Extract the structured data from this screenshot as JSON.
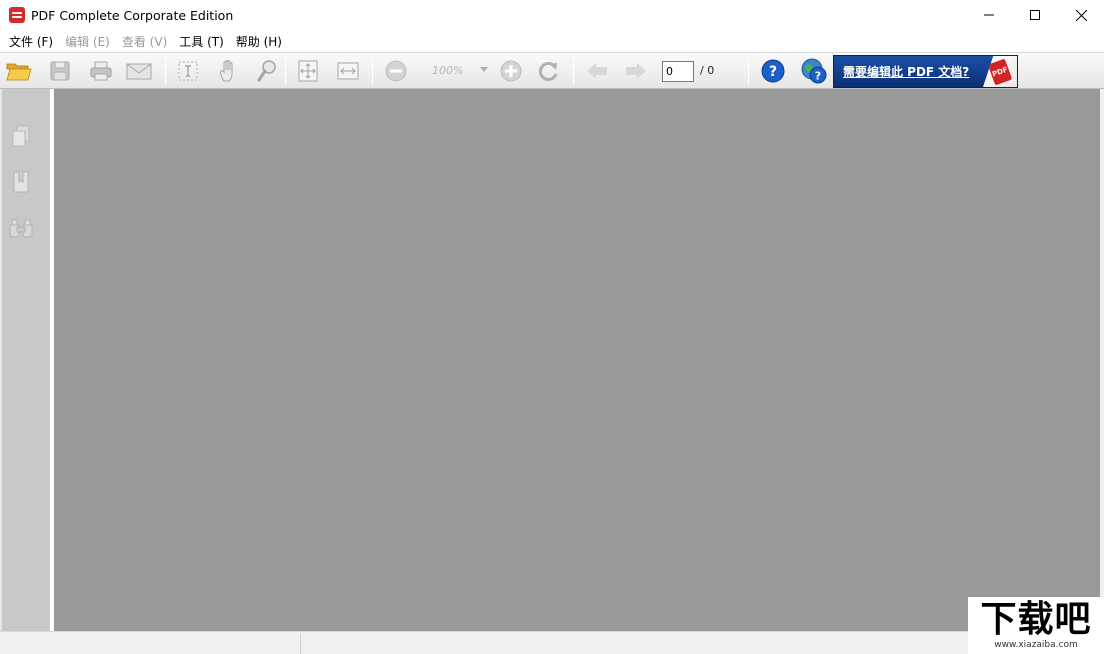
{
  "window": {
    "title": "PDF Complete Corporate Edition",
    "icon": "pdf-complete-app-icon"
  },
  "menu": {
    "items": [
      {
        "label": "文件 (F)",
        "enabled": true
      },
      {
        "label": "编辑 (E)",
        "enabled": false
      },
      {
        "label": "查看 (V)",
        "enabled": false
      },
      {
        "label": "工具 (T)",
        "enabled": true
      },
      {
        "label": "帮助 (H)",
        "enabled": true
      }
    ]
  },
  "toolbar": {
    "icons": [
      "open-folder-icon",
      "save-icon",
      "print-icon",
      "email-icon",
      "select-text-icon",
      "hand-tool-icon",
      "zoom-tool-icon",
      "fit-page-icon",
      "fit-width-icon",
      "zoom-out-icon",
      "zoom-in-icon",
      "rotate-icon",
      "previous-page-icon",
      "next-page-icon",
      "help-icon",
      "web-help-icon"
    ],
    "zoom_value": "100%",
    "page_current": "0",
    "page_total": "/ 0",
    "banner_text": "需要编辑此 PDF 文档?",
    "banner_badge": "PDF"
  },
  "sidebar": {
    "icons": [
      "pages-panel-icon",
      "bookmarks-panel-icon",
      "search-panel-icon"
    ]
  },
  "colors": {
    "doc_background": "#999999",
    "side_panel": "#c8c8c8",
    "banner_blue": "#1a4fa8",
    "help_blue": "#1c5fc8"
  },
  "watermark": {
    "main": "下载吧",
    "sub": "www.xiazaiba.com"
  }
}
